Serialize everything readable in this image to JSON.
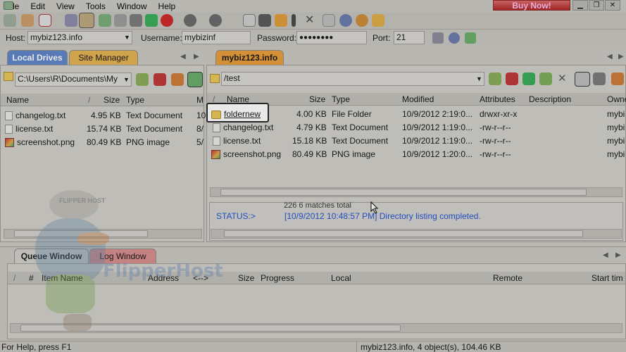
{
  "menu": [
    "File",
    "Edit",
    "View",
    "Tools",
    "Window",
    "Help"
  ],
  "buy_now": "Buy Now!",
  "connect": {
    "host_label": "Host:",
    "host_value": "mybiz123.info",
    "user_label": "Username:",
    "user_value": "mybizinf",
    "pass_label": "Password:",
    "pass_value": "●●●●●●●●",
    "port_label": "Port:",
    "port_value": "21"
  },
  "left_tabs": [
    "Local Drives",
    "Site Manager"
  ],
  "right_tab": "mybiz123.info",
  "left_path": "C:\\Users\\R\\Documents\\My",
  "right_path": "/test",
  "left_table": {
    "headers": [
      "Name",
      "/",
      "Size",
      "Type",
      "M"
    ],
    "rows": [
      [
        "changelog.txt",
        "4.95 KB",
        "Text Document",
        "10"
      ],
      [
        "license.txt",
        "15.74 KB",
        "Text Document",
        "8/"
      ],
      [
        "screenshot.png",
        "80.49 KB",
        "PNG image",
        "5/"
      ]
    ]
  },
  "right_table": {
    "headers": [
      "/",
      "Name",
      "Size",
      "Type",
      "Modified",
      "Attributes",
      "Description",
      "Owne"
    ],
    "rows": [
      [
        "foldernew",
        "4.00 KB",
        "File Folder",
        "10/9/2012 2:19:0...",
        "drwxr-xr-x",
        "mybi"
      ],
      [
        "changelog.txt",
        "4.79 KB",
        "Text Document",
        "10/9/2012 1:19:0...",
        "-rw-r--r--",
        "mybi"
      ],
      [
        "license.txt",
        "15.18 KB",
        "Text Document",
        "10/9/2012 1:19:0...",
        "-rw-r--r--",
        "mybi"
      ],
      [
        "screenshot.png",
        "80.49 KB",
        "PNG image",
        "10/9/2012 1:20:0...",
        "-rw-r--r--",
        "mybi"
      ]
    ]
  },
  "log": {
    "line1": "226 6 matches total",
    "status_label": "STATUS:>",
    "status_text": "[10/9/2012 10:48:57 PM] Directory listing completed."
  },
  "queue_tabs": [
    "Queue Window",
    "Log Window"
  ],
  "queue_headers": [
    "/",
    "#",
    "Item Name",
    "Address",
    "<-->",
    "Size",
    "Progress",
    "Local",
    "Remote",
    "Start tim"
  ],
  "status_left": "For Help, press F1",
  "status_right": "mybiz123.info, 4 object(s), 104.46 KB",
  "watermark": {
    "mascot": "FLIPPER HOST",
    "brand": "FlipperHost"
  },
  "colors": {
    "accent_blue": "#1a4fd0",
    "tab_orange": "#f0a830"
  }
}
